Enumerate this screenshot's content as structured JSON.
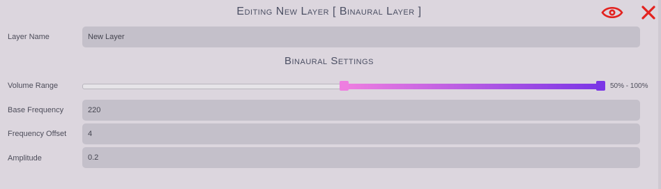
{
  "window": {
    "title": "Editing New Layer [ Binaural Layer ]"
  },
  "header_icons": {
    "visibility": "eye-icon",
    "close": "close-icon",
    "accent": "#e3221f"
  },
  "layer_name": {
    "label": "Layer Name",
    "value": "New Layer"
  },
  "section": {
    "title": "Binaural Settings"
  },
  "volume_range": {
    "label": "Volume Range",
    "min_fraction": 0.5,
    "max_fraction": 1.0,
    "value_text": "50% - 100%",
    "colors": {
      "low": "#ee7ee0",
      "high": "#7b36e6"
    }
  },
  "base_frequency": {
    "label": "Base Frequency",
    "value": "220"
  },
  "frequency_offset": {
    "label": "Frequency Offset",
    "value": "4"
  },
  "amplitude": {
    "label": "Amplitude",
    "value": "0.2"
  }
}
